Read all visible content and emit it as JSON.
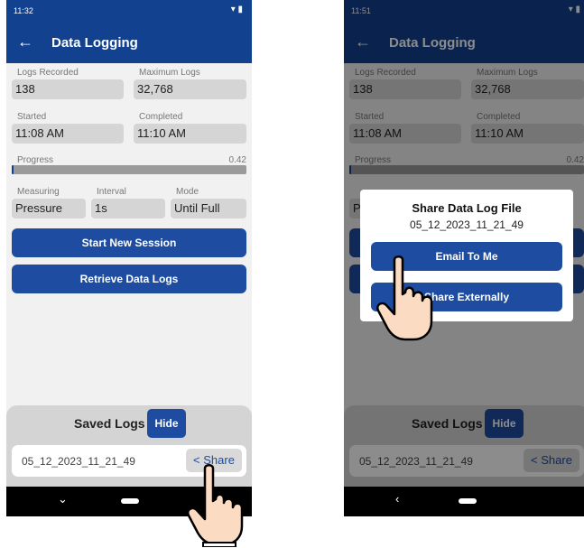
{
  "left": {
    "status": {
      "time": "11:32",
      "icons": "▾ ▮"
    },
    "appbar": {
      "back": "←",
      "title": "Data Logging"
    },
    "fields": {
      "logs_recorded_label": "Logs Recorded",
      "logs_recorded_value": "138",
      "max_logs_label": "Maximum Logs",
      "max_logs_value": "32,768",
      "started_label": "Started",
      "started_value": "11:08 AM",
      "completed_label": "Completed",
      "completed_value": "11:10 AM",
      "progress_label": "Progress",
      "progress_value": "0.42",
      "measuring_label": "Measuring",
      "measuring_value": "Pressure",
      "interval_label": "Interval",
      "interval_value": "1s",
      "mode_label": "Mode",
      "mode_value": "Until Full"
    },
    "buttons": {
      "start": "Start New Session",
      "retrieve": "Retrieve Data Logs"
    },
    "saved": {
      "title": "Saved Logs",
      "hide": "Hide",
      "file": "05_12_2023_11_21_49",
      "share": "Share"
    },
    "nav": {
      "back": "⌄"
    }
  },
  "right": {
    "status": {
      "time": "11:51",
      "icons": "▾ ▮"
    },
    "appbar": {
      "back": "←",
      "title": "Data Logging"
    },
    "fields": {
      "logs_recorded_label": "Logs Recorded",
      "logs_recorded_value": "138",
      "max_logs_label": "Maximum Logs",
      "max_logs_value": "32,768",
      "started_label": "Started",
      "started_value": "11:08 AM",
      "completed_label": "Completed",
      "completed_value": "11:10 AM",
      "progress_label": "Progress",
      "progress_value": "0.42",
      "measuring_value_partial": "P"
    },
    "saved": {
      "title": "Saved Logs",
      "hide": "Hide",
      "file": "05_12_2023_11_21_49",
      "share": "Share"
    },
    "dialog": {
      "title": "Share Data Log File",
      "subtitle": "05_12_2023_11_21_49",
      "email": "Email To Me",
      "external": "Share Externally"
    },
    "nav": {
      "back": "‹"
    }
  },
  "colors": {
    "primary": "#12418f",
    "button": "#1e4ca0",
    "field": "#d5d5d5",
    "panel": "#d4d4d4"
  },
  "icons": {
    "share": "share-icon",
    "back": "arrow-left-icon",
    "hand": "pointing-hand-icon"
  }
}
